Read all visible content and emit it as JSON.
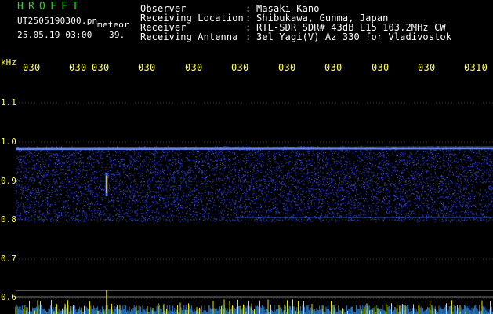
{
  "header": {
    "station_title": "HROFFT",
    "filename": "UT2505190300.pn",
    "mode": "meteor",
    "timestamp": "25.05.19 03:00",
    "count": "39.",
    "info": [
      {
        "label": "Observer",
        "value": "Masaki Kano"
      },
      {
        "label": "Receiving Location",
        "value": "Shibukawa, Gunma, Japan"
      },
      {
        "label": "Receiver",
        "value": "RTL-SDR SDR# 43dB L15 103.2MHz CW"
      },
      {
        "label": "Receiving Antenna",
        "value": "3el Yagi(V) Az 330 for Vladivostok"
      }
    ],
    "colon": ":"
  },
  "axis": {
    "unit": "kHz",
    "y_ticks": [
      "1.1",
      "1.0",
      "0.9",
      "0.8",
      "0.7",
      "0.6"
    ],
    "time_ticks": [
      "030",
      "030",
      "030",
      "030",
      "030",
      "030",
      "030",
      "030",
      "030",
      "0310"
    ]
  },
  "colors": {
    "title": "#33cc33",
    "label": "#ffff55",
    "text": "#ffffff",
    "noise": "#1a2fb0",
    "carrier": "#6f8fff",
    "meteor": "#ffd700",
    "level": "#e6e600"
  }
}
